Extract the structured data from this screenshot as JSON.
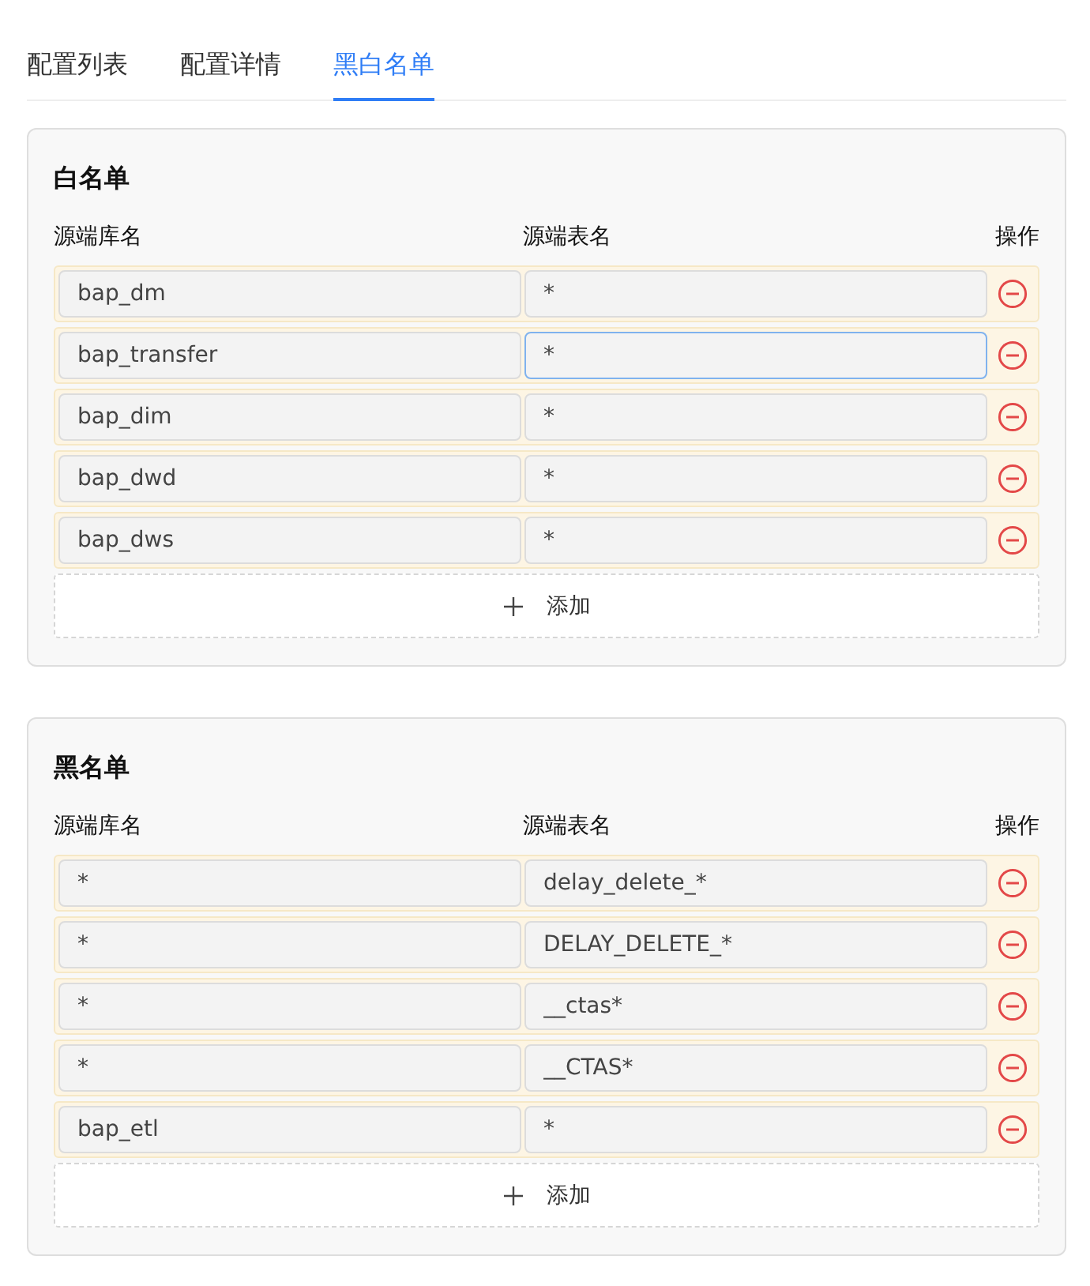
{
  "tabs": [
    {
      "label": "配置列表",
      "selected": false
    },
    {
      "label": "配置详情",
      "selected": false
    },
    {
      "label": "黑白名单",
      "selected": true
    }
  ],
  "lists": [
    {
      "title": "白名单",
      "columns": [
        "源端库名",
        "源端表名",
        "操作"
      ],
      "add_label": "添加",
      "rows": [
        {
          "database": "bap_dm",
          "table": "*",
          "table_focused": false
        },
        {
          "database": "bap_transfer",
          "table": "*",
          "table_focused": true
        },
        {
          "database": "bap_dim",
          "table": "*",
          "table_focused": false
        },
        {
          "database": "bap_dwd",
          "table": "*",
          "table_focused": false
        },
        {
          "database": "bap_dws",
          "table": "*",
          "table_focused": false
        }
      ]
    },
    {
      "title": "黑名单",
      "columns": [
        "源端库名",
        "源端表名",
        "操作"
      ],
      "add_label": "添加",
      "rows": [
        {
          "database": "*",
          "table": "delay_delete_*",
          "table_focused": false
        },
        {
          "database": "*",
          "table": "DELAY_DELETE_*",
          "table_focused": false
        },
        {
          "database": "*",
          "table": "__ctas*",
          "table_focused": false
        },
        {
          "database": "*",
          "table": "__CTAS*",
          "table_focused": false
        },
        {
          "database": "bap_etl",
          "table": "*",
          "table_focused": false
        }
      ]
    }
  ]
}
